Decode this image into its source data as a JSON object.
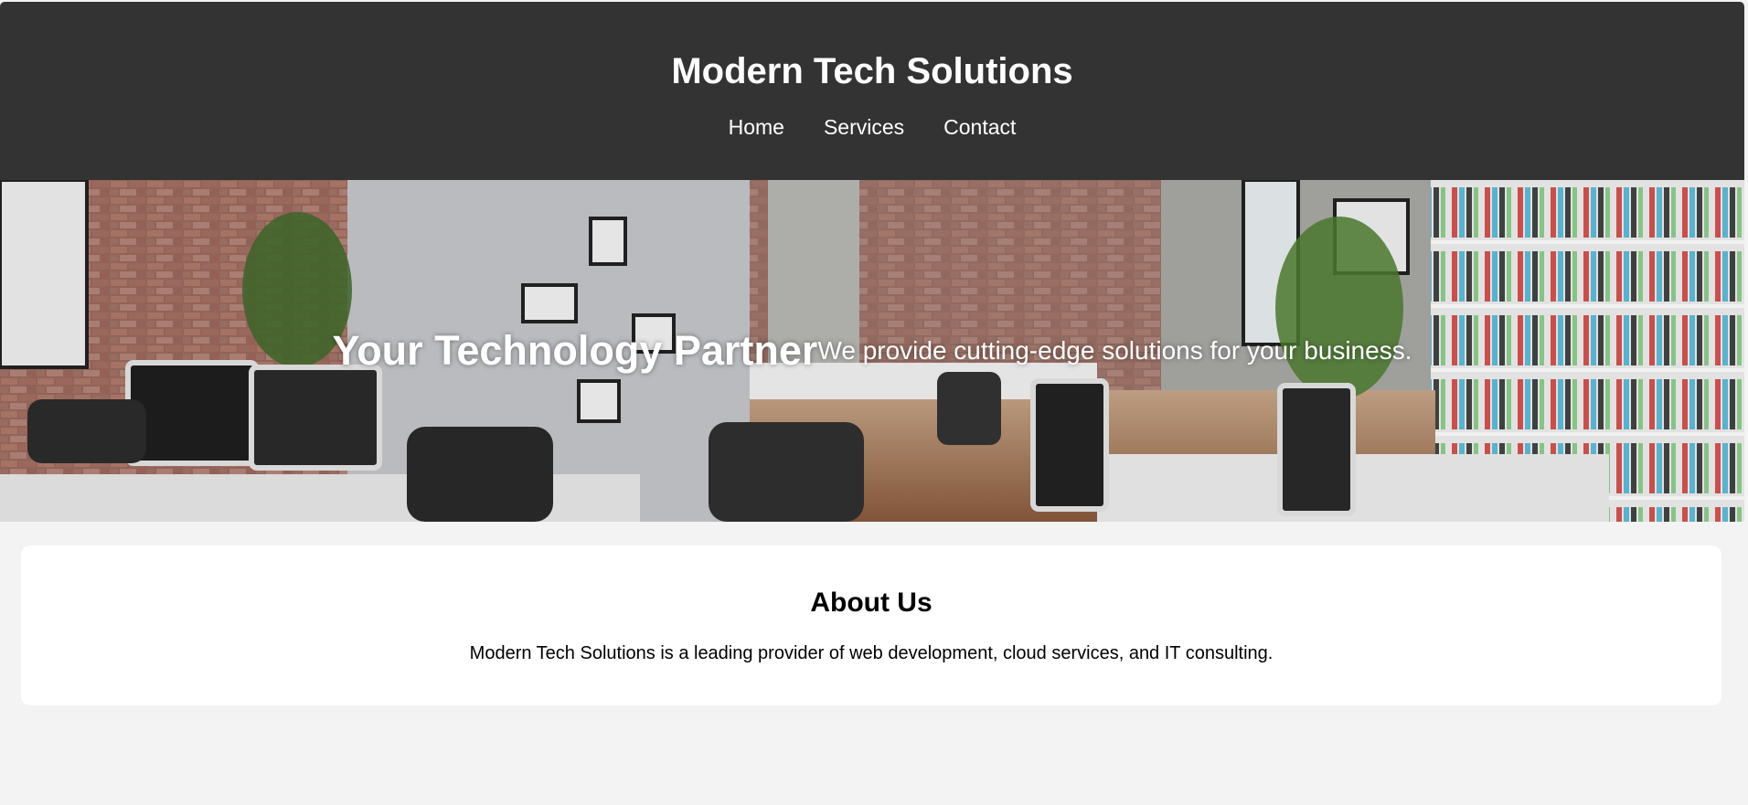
{
  "header": {
    "title": "Modern Tech Solutions",
    "nav": [
      {
        "label": "Home"
      },
      {
        "label": "Services"
      },
      {
        "label": "Contact"
      }
    ]
  },
  "hero": {
    "headline": "Your Technology Partner",
    "tagline": "We provide cutting-edge solutions for your business.",
    "image_label": "office-workspace-photo"
  },
  "about": {
    "title": "About Us",
    "text": "Modern Tech Solutions is a leading provider of web development, cloud services, and IT consulting."
  },
  "colors": {
    "header_bg": "#333333",
    "page_bg": "#f3f3f3",
    "card_bg": "#ffffff",
    "text_light": "#ffffff"
  }
}
